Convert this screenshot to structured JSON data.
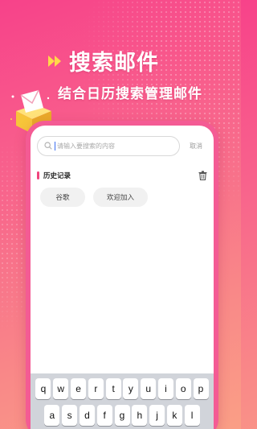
{
  "hero": {
    "title": "搜索邮件",
    "subtitle": "结合日历搜索管理邮件"
  },
  "search": {
    "placeholder": "请输入要搜索的内容",
    "cancel_label": "取消"
  },
  "history": {
    "title": "历史记录",
    "tags": [
      "谷歌",
      "欢迎加入"
    ]
  },
  "keyboard": {
    "row1": [
      "q",
      "w",
      "e",
      "r",
      "t",
      "y",
      "u",
      "i",
      "o",
      "p"
    ],
    "row2": [
      "a",
      "s",
      "d",
      "f",
      "g",
      "h",
      "j",
      "k",
      "l"
    ]
  },
  "colors": {
    "accent": "#f0457d",
    "phone_frame": "#f45b94",
    "caret": "#3a6df0"
  },
  "icons": [
    "fast-forward-icon",
    "mail-box-icon",
    "search-icon",
    "trash-icon"
  ]
}
